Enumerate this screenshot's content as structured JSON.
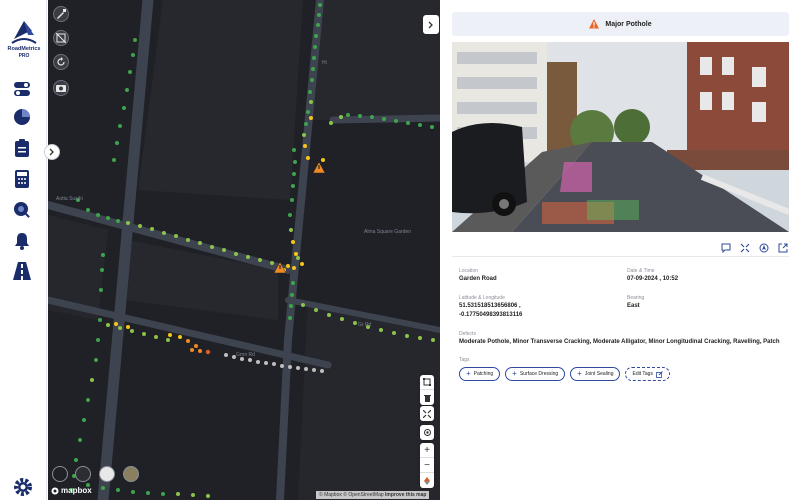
{
  "brand": {
    "name": "RoadMetrics",
    "tier": "PRO"
  },
  "sidebar": {
    "items": [
      {
        "icon": "toggle-icon"
      },
      {
        "icon": "pie-chart-icon"
      },
      {
        "icon": "clipboard-icon"
      },
      {
        "icon": "calculator-icon"
      },
      {
        "icon": "map-search-icon"
      },
      {
        "icon": "bell-icon"
      },
      {
        "icon": "road-icon"
      }
    ],
    "settings_icon": "gear-icon"
  },
  "map": {
    "labels": {
      "street1": "Aotta Susihi",
      "street2": "Alma Square Garden",
      "street3": "Hi",
      "street4": "Gr Rd",
      "street5": "Grnn Rd"
    },
    "attribution": {
      "mapbox": "© Mapbox",
      "osm": "© OpenStreetMap",
      "improve": "Improve this map"
    },
    "logo": "mapbox",
    "tools": [
      "brush-icon",
      "layers-off-icon",
      "rotate-icon",
      "camera-icon"
    ],
    "controls": [
      "polygon-icon",
      "trash-icon",
      "collapse-icon",
      "locate-icon",
      "zoom-in-icon",
      "zoom-out-icon",
      "compass-icon"
    ],
    "colors": {
      "good": "#3fa34d",
      "fair": "#8bc34a",
      "moderate": "#f5c518",
      "poor": "#f08a24",
      "severe": "#e25b1f",
      "unrated": "#bdbdbd"
    }
  },
  "defect": {
    "title": "Major Pothole",
    "icon": "warning-icon",
    "actions": [
      "comment-icon",
      "fullscreen-icon",
      "navigate-icon",
      "external-link-icon"
    ],
    "location_label": "Location",
    "location": "Garden Road",
    "datetime_label": "Date & Time",
    "datetime": "07-09-2024 , 10:52",
    "latlng_label": "Latitude & Longitude",
    "latitude": "51.531518513656806 ,",
    "longitude": "-0.17750498393813116",
    "bearing_label": "Bearing",
    "bearing": "East",
    "defects_label": "Defects",
    "defects": "Moderate Pothole, Minor Transverse Cracking, Moderate Alligator, Minor Longitudinal Cracking, Ravelling, Patch",
    "tags_label": "Tags",
    "tags": [
      "Patching",
      "Surface Dressing",
      "Joint Sealing"
    ],
    "edit_tags": "Edit Tags"
  }
}
